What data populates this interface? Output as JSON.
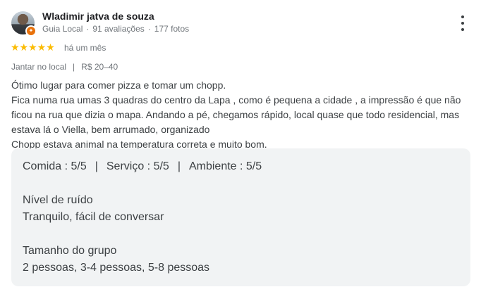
{
  "reviewer": {
    "name": "Wladimir jatva de souza",
    "role": "Guia Local",
    "reviews_count": "91 avaliações",
    "photos_count": "177 fotos"
  },
  "rating": {
    "stars": "★★★★★",
    "value": 5,
    "date": "há um mês"
  },
  "details": {
    "dining": "Jantar no local",
    "price": "R$ 20–40"
  },
  "review_text": [
    "Ótimo lugar para comer pizza e tomar um chopp.",
    "Fica numa rua umas 3 quadras do centro da Lapa , como é pequena a cidade , a impressão é que não",
    "ficou na rua que dizia o mapa. Andando a pé, chegamos rápido, local quase que todo residencial, mas",
    "estava lá o Viella, bem arrumado, organizado",
    "Chopp estava animal na temperatura correta e muito bom."
  ],
  "subratings": {
    "food": "Comida : 5/5",
    "service": "Serviço : 5/5",
    "ambience": "Ambiente : 5/5"
  },
  "attributes": [
    {
      "label": "Nível de ruído",
      "value": "Tranquilo, fácil de conversar"
    },
    {
      "label": "Tamanho do grupo",
      "value": "2 pessoas, 3-4 pessoas, 5-8 pessoas"
    }
  ],
  "colors": {
    "star": "#fbbc04",
    "badge": "#e8710a",
    "panel": "#f1f3f4"
  },
  "icons": {
    "more": "more-vert-icon",
    "badge": "local-guide-badge-icon"
  }
}
